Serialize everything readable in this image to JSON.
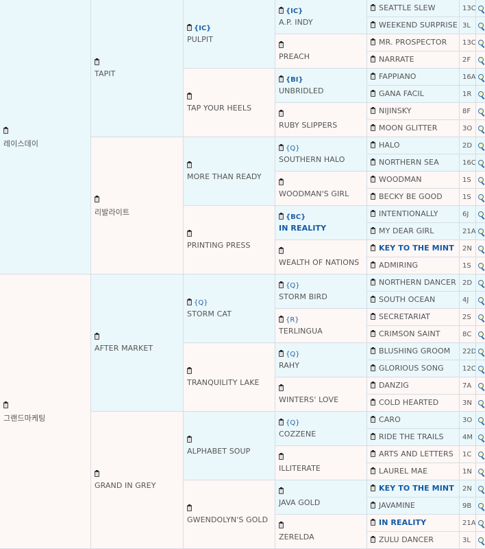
{
  "gen1": [
    {
      "name": "레이스데이"
    },
    {
      "name": "그랜드마케팅"
    }
  ],
  "gen2": [
    {
      "name": "TAPIT"
    },
    {
      "name": "리발라이트"
    },
    {
      "name": "AFTER MARKET"
    },
    {
      "name": "GRAND IN GREY"
    }
  ],
  "gen3": [
    {
      "name": "PULPIT",
      "tag": "{IC}"
    },
    {
      "name": "TAP YOUR HEELS"
    },
    {
      "name": "MORE THAN READY"
    },
    {
      "name": "PRINTING PRESS"
    },
    {
      "name": "STORM CAT",
      "tag": "{Q}"
    },
    {
      "name": "TRANQUILITY LAKE"
    },
    {
      "name": "ALPHABET SOUP"
    },
    {
      "name": "GWENDOLYN'S GOLD"
    }
  ],
  "gen4": [
    {
      "name": "A.P. INDY",
      "tag": "{IC}"
    },
    {
      "name": "PREACH"
    },
    {
      "name": "UNBRIDLED",
      "tag": "{BI}"
    },
    {
      "name": "RUBY SLIPPERS"
    },
    {
      "name": "SOUTHERN HALO",
      "tag": "{Q}"
    },
    {
      "name": "WOODMAN'S GIRL"
    },
    {
      "name": "IN REALITY",
      "tag": "{BC}",
      "highlight": true
    },
    {
      "name": "WEALTH OF NATIONS"
    },
    {
      "name": "STORM BIRD",
      "tag": "{Q}"
    },
    {
      "name": "TERLINGUA",
      "tag": "{R}"
    },
    {
      "name": "RAHY",
      "tag": "{Q}"
    },
    {
      "name": "WINTERS' LOVE"
    },
    {
      "name": "COZZENE",
      "tag": "{Q}"
    },
    {
      "name": "ILLITERATE"
    },
    {
      "name": "JAVA GOLD"
    },
    {
      "name": "ZERELDA"
    }
  ],
  "gen5": [
    {
      "name": "SEATTLE SLEW",
      "code": "13C"
    },
    {
      "name": "WEEKEND SURPRISE",
      "code": "3L"
    },
    {
      "name": "MR. PROSPECTOR",
      "code": "13C"
    },
    {
      "name": "NARRATE",
      "code": "2F"
    },
    {
      "name": "FAPPIANO",
      "code": "16A"
    },
    {
      "name": "GANA FACIL",
      "code": "1R"
    },
    {
      "name": "NIJINSKY",
      "code": "8F"
    },
    {
      "name": "MOON GLITTER",
      "code": "3O"
    },
    {
      "name": "HALO",
      "code": "2D"
    },
    {
      "name": "NORTHERN SEA",
      "code": "16C"
    },
    {
      "name": "WOODMAN",
      "code": "1S"
    },
    {
      "name": "BECKY BE GOOD",
      "code": "1S"
    },
    {
      "name": "INTENTIONALLY",
      "code": "6J"
    },
    {
      "name": "MY DEAR GIRL",
      "code": "21A"
    },
    {
      "name": "KEY TO THE MINT",
      "code": "2N",
      "highlight": true
    },
    {
      "name": "ADMIRING",
      "code": "1S"
    },
    {
      "name": "NORTHERN DANCER",
      "code": "2D"
    },
    {
      "name": "SOUTH OCEAN",
      "code": "4J"
    },
    {
      "name": "SECRETARIAT",
      "code": "2S"
    },
    {
      "name": "CRIMSON SAINT",
      "code": "8C"
    },
    {
      "name": "BLUSHING GROOM",
      "code": "22D"
    },
    {
      "name": "GLORIOUS SONG",
      "code": "12C"
    },
    {
      "name": "DANZIG",
      "code": "7A"
    },
    {
      "name": "COLD HEARTED",
      "code": "3N"
    },
    {
      "name": "CARO",
      "code": "3O"
    },
    {
      "name": "RIDE THE TRAILS",
      "code": "4M"
    },
    {
      "name": "ARTS AND LETTERS",
      "code": "1C"
    },
    {
      "name": "LAUREL MAE",
      "code": "1N"
    },
    {
      "name": "KEY TO THE MINT",
      "code": "2N",
      "highlight": true
    },
    {
      "name": "JAVAMINE",
      "code": "9B"
    },
    {
      "name": "IN REALITY",
      "code": "21A",
      "highlight": true
    },
    {
      "name": "ZULU DANCER",
      "code": "3L"
    }
  ]
}
